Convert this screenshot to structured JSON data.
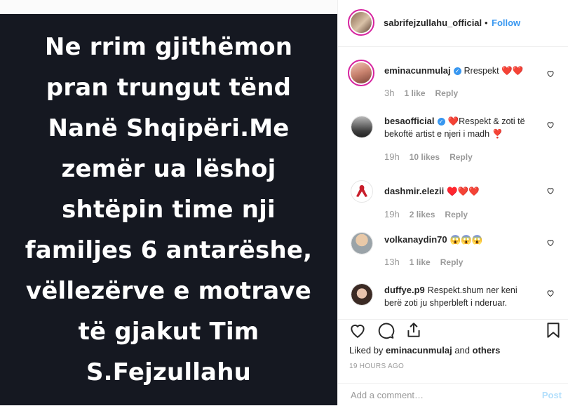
{
  "post": {
    "lines": [
      "Ne  rrim gjithëmon",
      "pran trungut tënd",
      "Nanë Shqipëri.Me",
      "zemër  ua  lëshoj",
      "shtëpin  time nji",
      "familjes 6 antarëshe,",
      "vëllezërve e motrave",
      "të gjakut Tim",
      "S.Fejzullahu"
    ]
  },
  "header": {
    "username": "sabrifejzullahu_official",
    "separator": "•",
    "follow_label": "Follow"
  },
  "comments": [
    {
      "username": "eminacunmulaj",
      "text": "Rrespekt ❤️❤️",
      "verified": true,
      "time": "3h",
      "likes": "1 like",
      "reply": "Reply"
    },
    {
      "username": "besaofficial",
      "text": "❤️Respekt & zoti të bekoftë artist e njeri i madh ❣️",
      "verified": true,
      "time": "19h",
      "likes": "10 likes",
      "reply": "Reply"
    },
    {
      "username": "dashmir.elezii",
      "text": "♥️❤️❤️",
      "verified": false,
      "time": "19h",
      "likes": "2 likes",
      "reply": "Reply"
    },
    {
      "username": "volkanaydin70",
      "text": "😱😱😱",
      "verified": false,
      "time": "13h",
      "likes": "1 like",
      "reply": "Reply"
    },
    {
      "username": "duffye.p9",
      "text": "Respekt.shum ner keni berë zoti ju shperbleft i nderuar.",
      "verified": false,
      "time": "",
      "likes": "",
      "reply": ""
    }
  ],
  "likes": {
    "prefix": "Liked by",
    "user": "eminacunmulaj",
    "and": "and",
    "others": "others"
  },
  "timestamp": "19 HOURS AGO",
  "add_comment": {
    "placeholder": "Add a comment…",
    "post_label": "Post"
  },
  "colors": {
    "post_bg": "#151821",
    "accent": "#3897f0",
    "muted": "#999999"
  }
}
